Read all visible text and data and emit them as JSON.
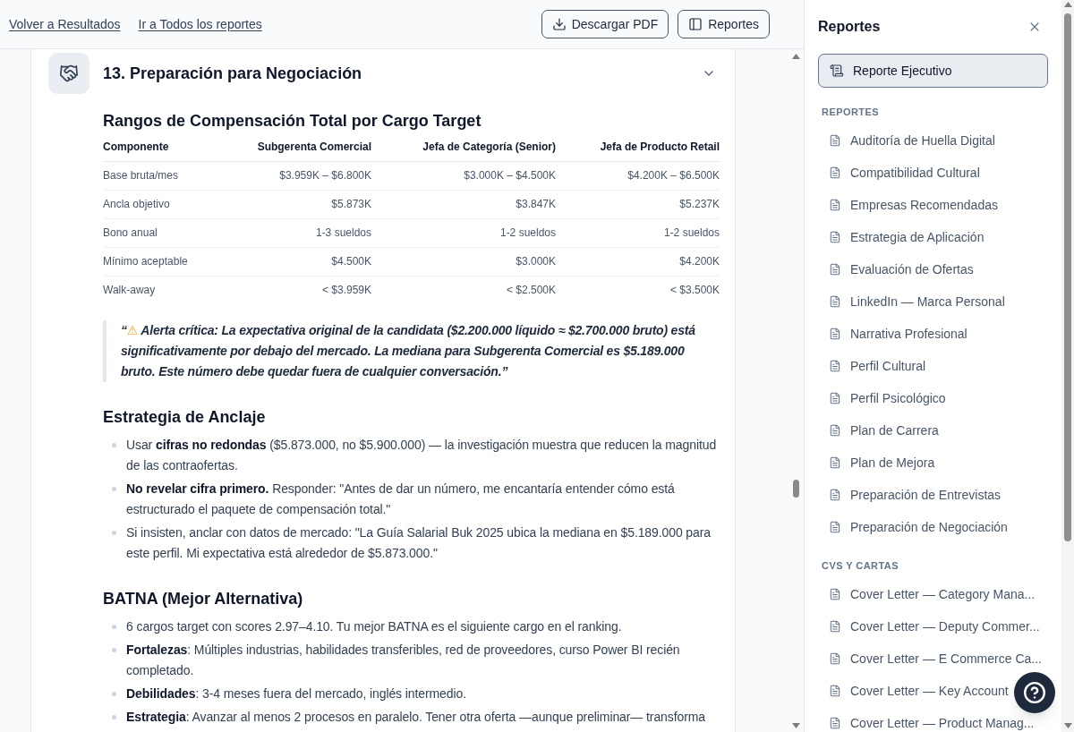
{
  "top_bar": {
    "links": [
      "Volver a Resultados",
      "Ir a Todos los reportes"
    ],
    "buttons": [
      {
        "label": "Descargar PDF",
        "kind": "download"
      },
      {
        "label": "Reportes",
        "kind": "panel"
      }
    ]
  },
  "section": {
    "title": "13. Preparación para Negociación",
    "expanded": true,
    "table": {
      "title": "Rangos de Compensación Total por Cargo Target",
      "columns": [
        "Componente",
        "Subgerenta Comercial",
        "Jefa de Categoría (Senior)",
        "Jefa de Producto Retail"
      ],
      "rows": [
        [
          "Base bruta/mes",
          "$3.959K – $6.800K",
          "$3.000K – $4.500K",
          "$4.200K – $6.500K"
        ],
        [
          "Ancla objetivo",
          "$5.873K",
          "$3.847K",
          "$5.237K"
        ],
        [
          "Bono anual",
          "1-3 sueldos",
          "1-2 sueldos",
          "1-2 sueldos"
        ],
        [
          "Mínimo aceptable",
          "$4.500K",
          "$3.000K",
          "$4.200K"
        ],
        [
          "Walk-away",
          "< $3.959K",
          "< $2.500K",
          "< $3.500K"
        ]
      ]
    },
    "quote": {
      "open_mark": "“",
      "icon": "⚠",
      "text": "Alerta crítica: La expectativa original de la candidata ($2.200.000 líquido ≈ $2.700.000 bruto) está significativamente por debajo del mercado. La mediana para Subgerenta Comercial es $5.189.000 bruto. Este número debe quedar fuera de cualquier conversación.”"
    },
    "subsections": [
      {
        "title": "Estrategia de Anclaje",
        "items": [
          "Usar **cifras no redondas** ($5.873.000, no $5.900.000) — la investigación muestra que reducen la magnitud de las contraofertas.",
          "**No revelar cifra primero.** Responder: \"Antes de dar un número, me encantaría entender cómo está estructurado el paquete de compensación total.\"",
          "Si insisten, anclar con datos de mercado: \"La Guía Salarial Buk 2025 ubica la mediana en $5.189.000 para este perfil. Mi expectativa está alrededor de $5.873.000.\""
        ]
      },
      {
        "title": "BATNA (Mejor Alternativa)",
        "items": [
          "6 cargos target con scores 2.97–4.10. Tu mejor BATNA es el siguiente cargo en el ranking.",
          "**Fortalezas**: Múltiples industrias, habilidades transferibles, red de proveedores, curso Power BI recién completado.",
          "**Debilidades**: 3-4 meses fuera del mercado, inglés intermedio.",
          "**Estrategia**: Avanzar al menos 2 procesos en paralelo. Tener otra oferta —aunque preliminar— transforma"
        ]
      }
    ]
  },
  "sidebar": {
    "title": "Reportes",
    "featured": {
      "label": "Reporte Ejecutivo",
      "selected": true
    },
    "groups": [
      {
        "label": "REPORTES",
        "items": [
          {
            "label": "Auditoría de Huella Digital",
            "selected": false
          },
          {
            "label": "Compatibilidad Cultural",
            "selected": false
          },
          {
            "label": "Empresas Recomendadas",
            "selected": false
          },
          {
            "label": "Estrategia de Aplicación",
            "selected": false
          },
          {
            "label": "Evaluación de Ofertas",
            "selected": false
          },
          {
            "label": "LinkedIn — Marca Personal",
            "selected": false
          },
          {
            "label": "Narrativa Profesional",
            "selected": false
          },
          {
            "label": "Perfil Cultural",
            "selected": false
          },
          {
            "label": "Perfil Psicológico",
            "selected": false
          },
          {
            "label": "Plan de Carrera",
            "selected": false
          },
          {
            "label": "Plan de Mejora",
            "selected": false
          },
          {
            "label": "Preparación de Entrevistas",
            "selected": false
          },
          {
            "label": "Preparación de Negociación",
            "selected": false
          }
        ]
      },
      {
        "label": "CVS Y CARTAS",
        "items": [
          {
            "label": "Cover Letter — Category Mana...",
            "selected": false
          },
          {
            "label": "Cover Letter — Deputy Commer...",
            "selected": false
          },
          {
            "label": "Cover Letter — E Commerce Ca...",
            "selected": false
          },
          {
            "label": "Cover Letter — Key Account",
            "selected": false
          },
          {
            "label": "Cover Letter — Product Manag...",
            "selected": false
          }
        ]
      }
    ]
  }
}
